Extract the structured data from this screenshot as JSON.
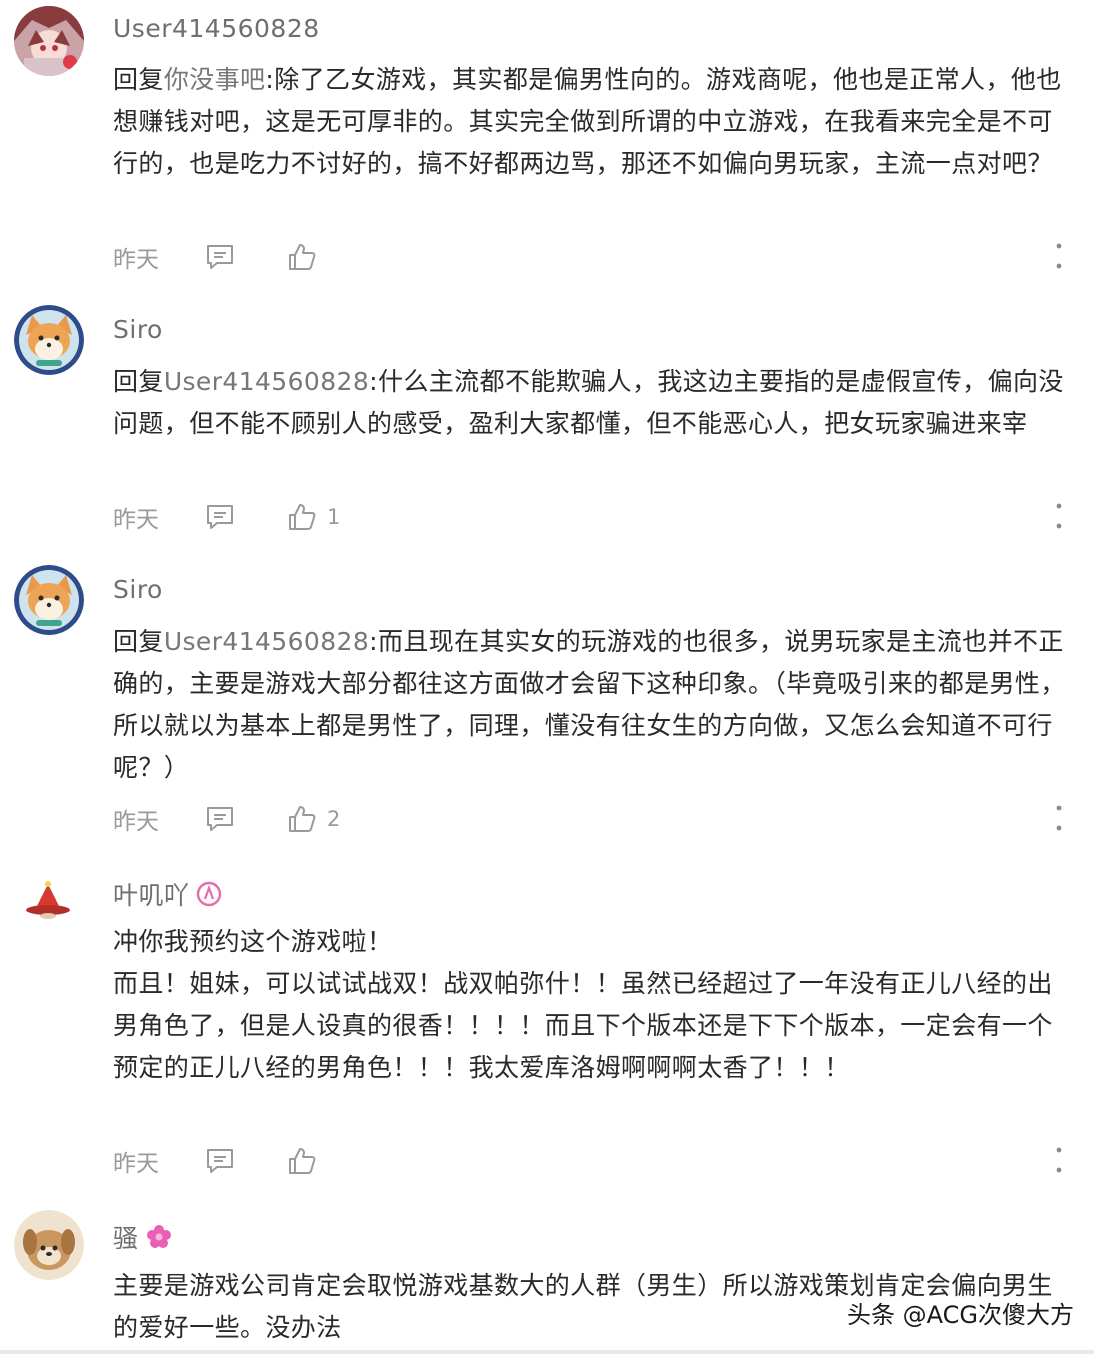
{
  "comments": [
    {
      "username": "User414560828",
      "reply_prefix": "回复",
      "reply_target": "你没事吧",
      "reply_colon": ":",
      "text": "除了乙女游戏，其实都是偏男性向的。游戏商呢，他也是正常人，他也想赚钱对吧，这是无可厚非的。其实完全做到所谓的中立游戏，在我看来完全是不可行的，也是吃力不讨好的，搞不好都两边骂，那还不如偏向男玩家，主流一点对吧？",
      "time": "昨天",
      "likes": ""
    },
    {
      "username": "Siro",
      "reply_prefix": "回复",
      "reply_target": "User414560828",
      "reply_colon": ":",
      "text": "什么主流都不能欺骗人，我这边主要指的是虚假宣传，偏向没问题，但不能不顾别人的感受，盈利大家都懂，但不能恶心人，把女玩家骗进来宰",
      "time": "昨天",
      "likes": "1"
    },
    {
      "username": "Siro",
      "reply_prefix": "回复",
      "reply_target": "User414560828",
      "reply_colon": ":",
      "text": "而且现在其实女的玩游戏的也很多，说男玩家是主流也并不正确的，主要是游戏大部分都往这方面做才会留下这种印象。（毕竟吸引来的都是男性，所以就以为基本上都是男性了，同理，懂没有往女生的方向做，又怎么会知道不可行呢？）",
      "time": "昨天",
      "likes": "2"
    },
    {
      "username": "叶叽吖",
      "text_lines": [
        "冲你我预约这个游戏啦！",
        "而且！姐妹，可以试试战双！战双帕弥什！！虽然已经超过了一年没有正儿八经的出男角色了，但是人设真的很香！！！！而且下个版本还是下下个版本，一定会有一个预定的正儿八经的男角色！！！我太爱库洛姆啊啊啊太香了！！！"
      ],
      "time": "昨天",
      "likes": ""
    },
    {
      "username": "骚",
      "text": "主要是游戏公司肯定会取悦游戏基数大的人群（男生）所以游戏策划肯定会偏向男生的爱好一些。没办法",
      "time": "",
      "likes": ""
    }
  ],
  "watermark": "头条 @ACG次傻大方",
  "colors": {
    "text": "#2a2a2a",
    "muted": "#9a9a9a",
    "username": "#6f6f6f",
    "badge_pink": "#e86aa8",
    "flower_pink": "#e85fb5"
  }
}
